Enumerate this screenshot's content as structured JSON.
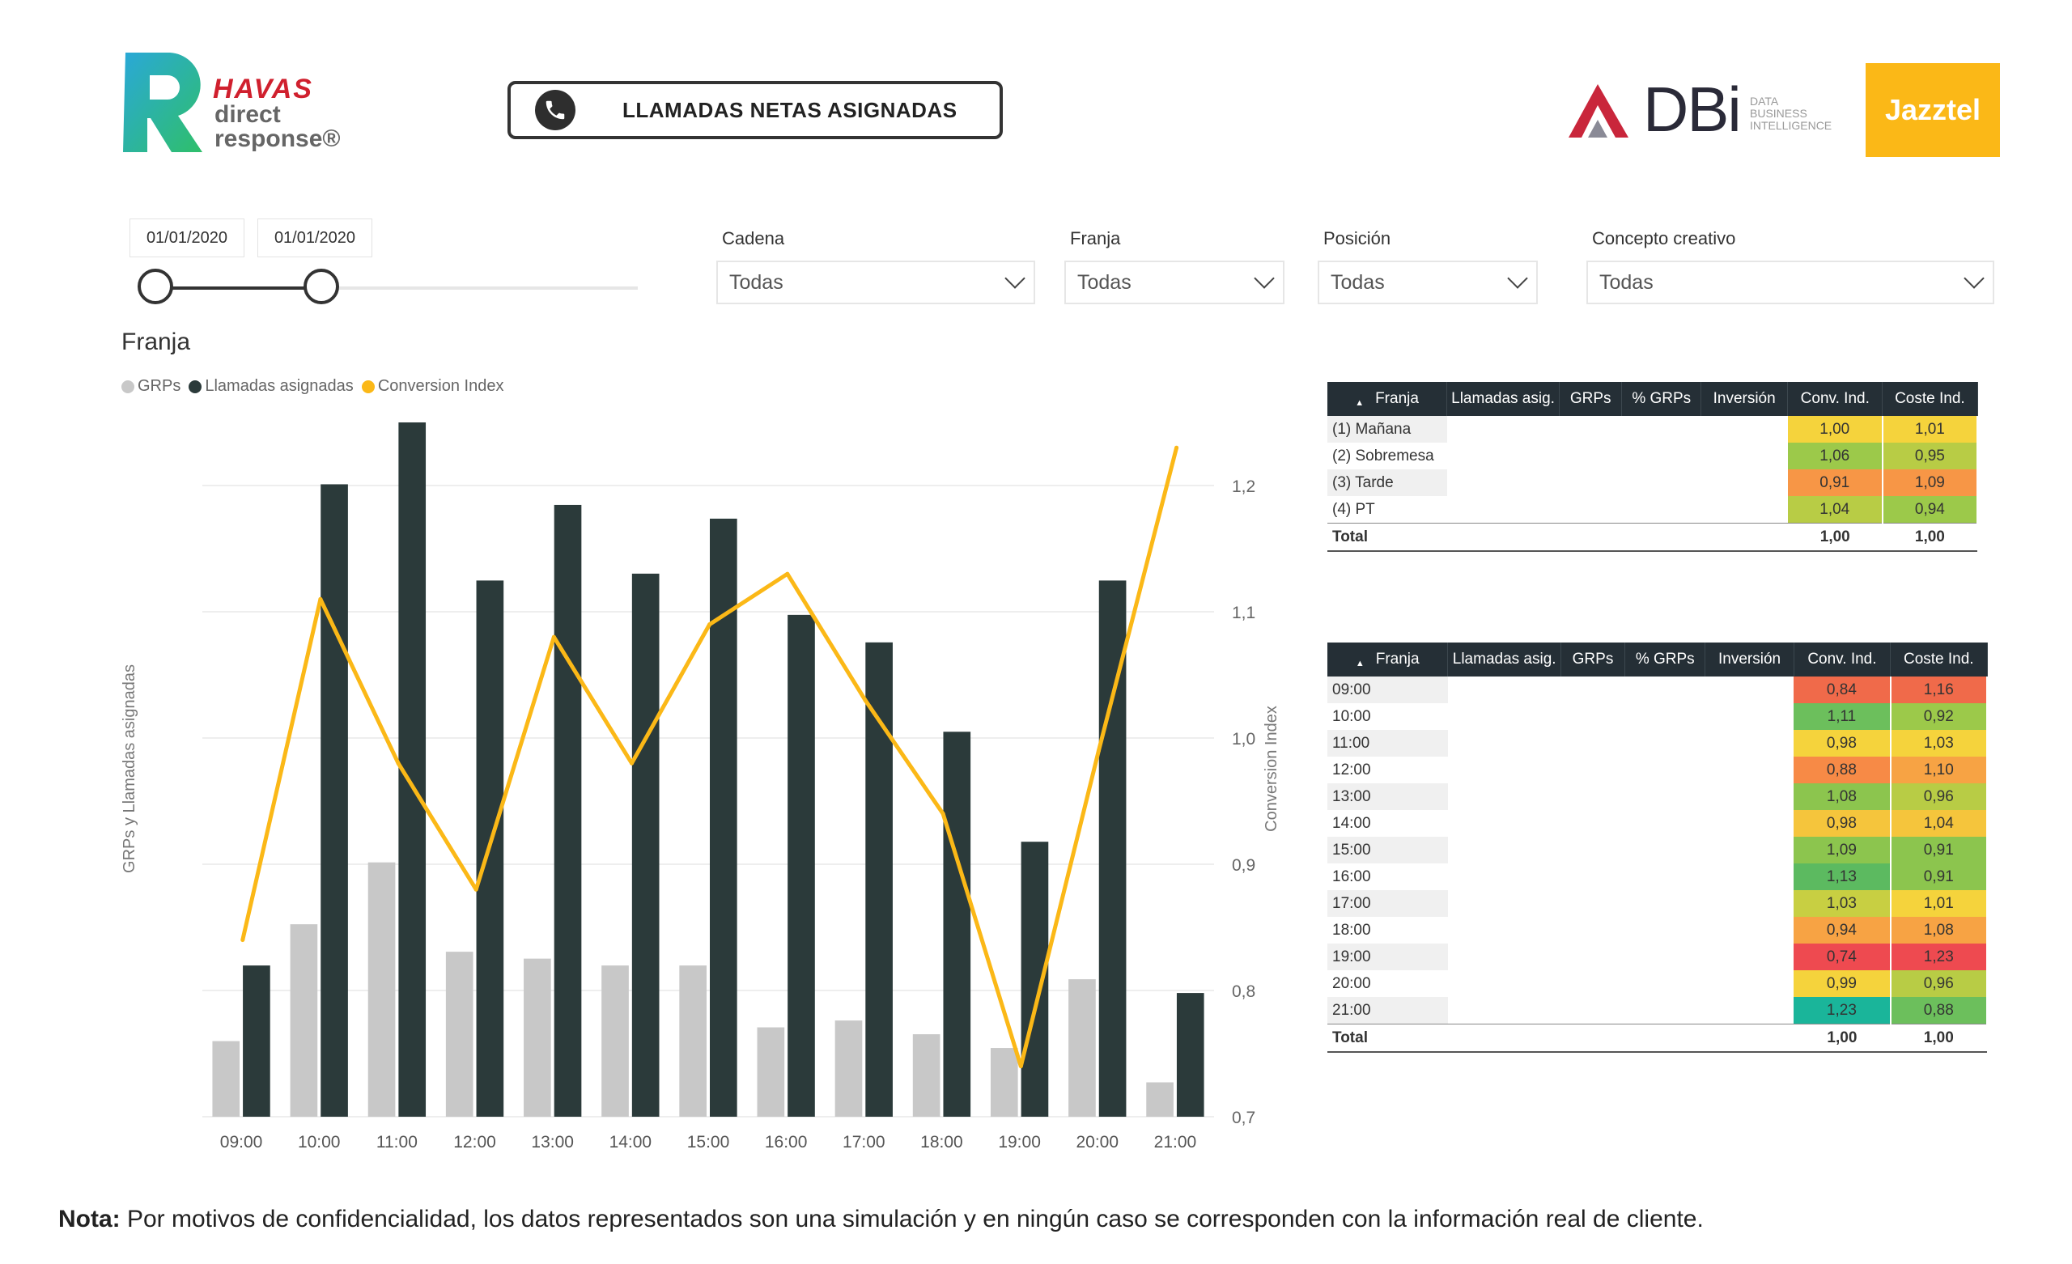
{
  "header": {
    "havas_logo": {
      "brand": "HAVAS",
      "line1": "direct",
      "line2": "response®"
    },
    "report_title": "LLAMADAS NETAS ASIGNADAS",
    "dbi_logo": {
      "brand": "DBi",
      "sub": [
        "DATA",
        "BUSINESS",
        "INTELLIGENCE"
      ]
    },
    "client_logo": "Jazztel"
  },
  "filters": {
    "date_from": "01/01/2020",
    "date_to": "01/01/2020",
    "dropdowns": [
      {
        "label": "Cadena",
        "value": "Todas"
      },
      {
        "label": "Franja",
        "value": "Todas"
      },
      {
        "label": "Posición",
        "value": "Todas"
      },
      {
        "label": "Concepto creativo",
        "value": "Todas"
      }
    ]
  },
  "chart_section_title": "Franja",
  "chart_data": {
    "type": "bar",
    "categories": [
      "09:00",
      "10:00",
      "11:00",
      "12:00",
      "13:00",
      "14:00",
      "15:00",
      "16:00",
      "17:00",
      "18:00",
      "19:00",
      "20:00",
      "21:00"
    ],
    "series": [
      {
        "name": "GRPs",
        "type": "bar",
        "axis": "left",
        "color": "#c8c8c8",
        "values": [
          11,
          28,
          37,
          24,
          23,
          22,
          22,
          13,
          14,
          12,
          10,
          20,
          5
        ]
      },
      {
        "name": "Llamadas asignadas",
        "type": "bar",
        "axis": "left",
        "color": "#2b3a3a",
        "values": [
          22,
          92,
          101,
          78,
          89,
          79,
          87,
          73,
          69,
          56,
          40,
          78,
          18
        ]
      },
      {
        "name": "Conversion Index",
        "type": "line",
        "axis": "right",
        "color": "#fbb817",
        "values": [
          0.84,
          1.11,
          0.98,
          0.88,
          1.08,
          0.98,
          1.09,
          1.13,
          1.03,
          0.94,
          0.74,
          0.99,
          1.23
        ]
      }
    ],
    "ylabel": "GRPs y Llamadas asignadas",
    "y2label": "Conversion Index",
    "ylim": [
      0,
      101
    ],
    "y2lim": [
      0.7,
      1.25
    ],
    "y2ticks": [
      "1,2",
      "1,1",
      "1,0",
      "0,9",
      "0,8",
      "0,7"
    ],
    "legend": "top-left",
    "grid": true
  },
  "table_franja": {
    "headers": [
      "Franja",
      "Llamadas asig.",
      "GRPs",
      "% GRPs",
      "Inversión",
      "Conv. Ind.",
      "Coste Ind."
    ],
    "rows": [
      {
        "franja": "(1) Mañana",
        "conv": "1,00",
        "coste": "1,01",
        "conv_color": "#f5d33c",
        "coste_color": "#f5d33c"
      },
      {
        "franja": "(2) Sobremesa",
        "conv": "1,06",
        "coste": "0,95",
        "conv_color": "#9cc94a",
        "coste_color": "#b8cc45"
      },
      {
        "franja": "(3) Tarde",
        "conv": "0,91",
        "coste": "1,09",
        "conv_color": "#f79646",
        "coste_color": "#f79646"
      },
      {
        "franja": "(4) PT",
        "conv": "1,04",
        "coste": "0,94",
        "conv_color": "#b8cc45",
        "coste_color": "#9cc94a"
      }
    ],
    "total": {
      "label": "Total",
      "conv": "1,00",
      "coste": "1,00"
    }
  },
  "table_hora": {
    "headers": [
      "Franja",
      "Llamadas asig.",
      "GRPs",
      "% GRPs",
      "Inversión",
      "Conv. Ind.",
      "Coste Ind."
    ],
    "rows": [
      {
        "franja": "09:00",
        "conv": "0,84",
        "coste": "1,16",
        "conv_color": "#f06a4a",
        "coste_color": "#f06a4a"
      },
      {
        "franja": "10:00",
        "conv": "1,11",
        "coste": "0,92",
        "conv_color": "#6cbf5c",
        "coste_color": "#9cc94a"
      },
      {
        "franja": "11:00",
        "conv": "0,98",
        "coste": "1,03",
        "conv_color": "#f5d33c",
        "coste_color": "#f5d33c"
      },
      {
        "franja": "12:00",
        "conv": "0,88",
        "coste": "1,10",
        "conv_color": "#f78a46",
        "coste_color": "#f7a344"
      },
      {
        "franja": "13:00",
        "conv": "1,08",
        "coste": "0,96",
        "conv_color": "#8cc54e",
        "coste_color": "#b8cc45"
      },
      {
        "franja": "14:00",
        "conv": "0,98",
        "coste": "1,04",
        "conv_color": "#f5c53c",
        "coste_color": "#f5c53c"
      },
      {
        "franja": "15:00",
        "conv": "1,09",
        "coste": "0,91",
        "conv_color": "#8cc54e",
        "coste_color": "#8cc54e"
      },
      {
        "franja": "16:00",
        "conv": "1,13",
        "coste": "0,91",
        "conv_color": "#5cba60",
        "coste_color": "#8cc54e"
      },
      {
        "franja": "17:00",
        "conv": "1,03",
        "coste": "1,01",
        "conv_color": "#c8cf42",
        "coste_color": "#f5d33c"
      },
      {
        "franja": "18:00",
        "conv": "0,94",
        "coste": "1,08",
        "conv_color": "#f7a344",
        "coste_color": "#f7a344"
      },
      {
        "franja": "19:00",
        "conv": "0,74",
        "coste": "1,23",
        "conv_color": "#ee4a50",
        "coste_color": "#ee4a50"
      },
      {
        "franja": "20:00",
        "conv": "0,99",
        "coste": "0,96",
        "conv_color": "#f5d33c",
        "coste_color": "#b8cc45"
      },
      {
        "franja": "21:00",
        "conv": "1,23",
        "coste": "0,88",
        "conv_color": "#1ab59a",
        "coste_color": "#6cbf5c"
      }
    ],
    "total": {
      "label": "Total",
      "conv": "1,00",
      "coste": "1,00"
    }
  },
  "note": {
    "label": "Nota:",
    "text": " Por motivos de confidencialidad, los datos representados  son una simulación y en ningún caso se corresponden con la  información real de cliente."
  }
}
